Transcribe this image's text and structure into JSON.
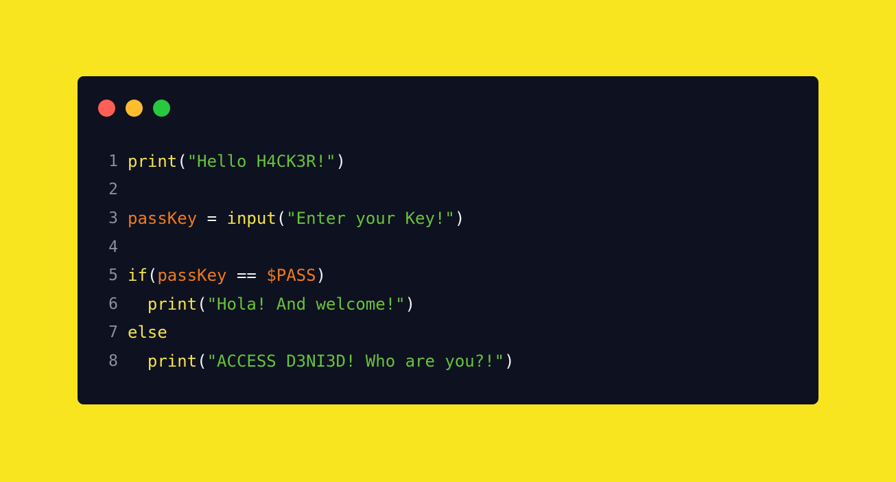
{
  "colors": {
    "background": "#f8e51f",
    "window": "#0e1120",
    "traffic_close": "#ff5f57",
    "traffic_minimize": "#febc2e",
    "traffic_zoom": "#28c840",
    "line_number": "#8d8f99",
    "function": "#f4e24a",
    "string": "#67c23a",
    "variable": "#f07a1c",
    "punctuation": "#f2f2f2"
  },
  "window_controls": [
    {
      "name": "close-button",
      "icon": "red-circle-icon"
    },
    {
      "name": "minimize-button",
      "icon": "yellow-circle-icon"
    },
    {
      "name": "zoom-button",
      "icon": "green-circle-icon"
    }
  ],
  "code": {
    "lines": [
      {
        "number": "1",
        "tokens": [
          {
            "text": "print",
            "kind": "function"
          },
          {
            "text": "(",
            "kind": "punctuation"
          },
          {
            "text": "\"Hello H4CK3R!\"",
            "kind": "string"
          },
          {
            "text": ")",
            "kind": "punctuation"
          }
        ]
      },
      {
        "number": "2",
        "tokens": []
      },
      {
        "number": "3",
        "tokens": [
          {
            "text": "passKey",
            "kind": "variable"
          },
          {
            "text": " = ",
            "kind": "punctuation"
          },
          {
            "text": "input",
            "kind": "function"
          },
          {
            "text": "(",
            "kind": "punctuation"
          },
          {
            "text": "\"Enter your Key!\"",
            "kind": "string"
          },
          {
            "text": ")",
            "kind": "punctuation"
          }
        ]
      },
      {
        "number": "4",
        "tokens": []
      },
      {
        "number": "5",
        "tokens": [
          {
            "text": "if",
            "kind": "function"
          },
          {
            "text": "(",
            "kind": "punctuation"
          },
          {
            "text": "passKey",
            "kind": "variable"
          },
          {
            "text": " == ",
            "kind": "punctuation"
          },
          {
            "text": "$PASS",
            "kind": "variable"
          },
          {
            "text": ")",
            "kind": "punctuation"
          }
        ]
      },
      {
        "number": "6",
        "tokens": [
          {
            "text": "  ",
            "kind": "punctuation"
          },
          {
            "text": "print",
            "kind": "function"
          },
          {
            "text": "(",
            "kind": "punctuation"
          },
          {
            "text": "\"Hola! And welcome!\"",
            "kind": "string"
          },
          {
            "text": ")",
            "kind": "punctuation"
          }
        ]
      },
      {
        "number": "7",
        "tokens": [
          {
            "text": "else",
            "kind": "function"
          }
        ]
      },
      {
        "number": "8",
        "tokens": [
          {
            "text": "  ",
            "kind": "punctuation"
          },
          {
            "text": "print",
            "kind": "function"
          },
          {
            "text": "(",
            "kind": "punctuation"
          },
          {
            "text": "\"ACCESS D3NI3D! Who are you?!\"",
            "kind": "string"
          },
          {
            "text": ")",
            "kind": "punctuation"
          }
        ]
      }
    ]
  }
}
